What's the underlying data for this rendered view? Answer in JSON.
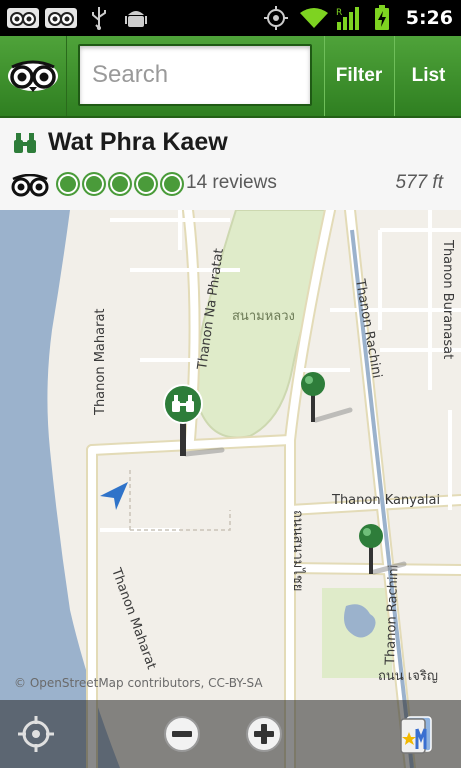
{
  "status_bar": {
    "time": "5:26",
    "icons": [
      "tripadvisor-notification-icon",
      "tripadvisor-notification-icon",
      "usb-icon",
      "android-debug-icon",
      "gps-icon",
      "wifi-icon",
      "signal-icon",
      "battery-charging-icon"
    ],
    "signal_type": "R"
  },
  "toolbar": {
    "logo_icon": "tripadvisor-owl-logo",
    "search_placeholder": "Search",
    "filter_label": "Filter",
    "list_label": "List"
  },
  "place": {
    "category_icon": "binoculars-icon",
    "name": "Wat Phra Kaew",
    "rating_bubbles": 5,
    "reviews": "14 reviews",
    "distance": "577 ft"
  },
  "map": {
    "streets": {
      "na_phratat": "Thanon Na Phratat",
      "maharat_top": "Thanon Maharat",
      "maharat_bottom": "Thanon Maharat",
      "rachini_top": "Thanon Rachini",
      "rachini_bottom": "Thanon Rachini",
      "buranasat": "Thanon Buranasat",
      "kanyalai": "Thanon Kanyalai",
      "thai_park": "สนามหลวง",
      "thai_road": "ถนนสนามไชย",
      "thai_bottom": "ถนน เจริญ"
    },
    "attribution": "© OpenStreetMap contributors, CC-BY-SA",
    "colors": {
      "water": "#9bb2cc",
      "park": "#dfebc9",
      "road": "#ffffff",
      "road_edge": "#e3dbb7",
      "canal": "#9bb2cc",
      "pin_green": "#2e7d3a"
    }
  },
  "bottom_bar": {
    "locate_icon": "my-location-icon",
    "zoom_out_icon": "zoom-out-icon",
    "zoom_in_icon": "zoom-in-icon",
    "layers_icon": "map-layers-icon"
  }
}
